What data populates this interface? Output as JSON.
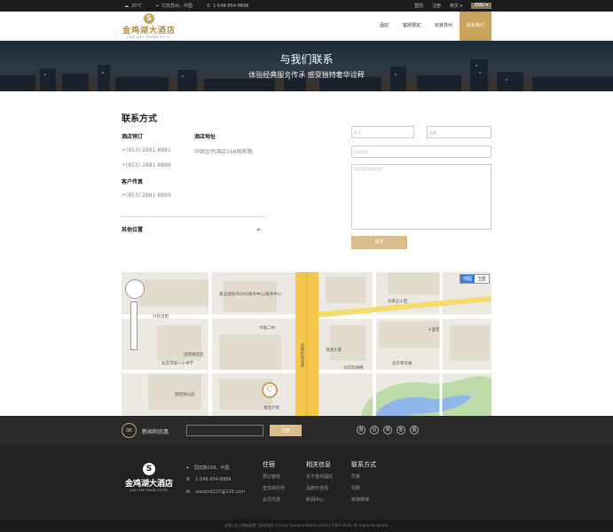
{
  "topbar": {
    "weather": "20℃",
    "location": "江苏苏州，中国",
    "phone": "1-548-854-8898",
    "links": [
      "登陆",
      "注册",
      "英文 ▾"
    ],
    "lang": "ENG ▾"
  },
  "brand": {
    "name_cn": "金鸡湖大酒店",
    "name_en": "JINJI LAKE GRAND HOTEL",
    "mark": "S"
  },
  "nav": [
    "酒店",
    "客房预定",
    "玩转苏州",
    "联系我们"
  ],
  "banner": {
    "title": "与我们联系",
    "subtitle": "体验经典服务传承 感受独特奢华诠释"
  },
  "contact": {
    "title": "联系方式",
    "booking_label": "酒店预订",
    "booking_phones": [
      "+(853) 2881-8881",
      "+(853) 2881-8888"
    ],
    "fax_label": "客户传真",
    "fax_phone": "+(853) 2881-8899",
    "address_label": "酒店地址",
    "address": "中国金鸡酒店168国宾路",
    "other_locations": "其他位置"
  },
  "form": {
    "name_ph": "姓名",
    "email_ph": "邮箱",
    "contact_ph": "联系电话",
    "message_ph": "请给我们留言信息",
    "submit": "提交"
  },
  "map": {
    "toggle_map": "地图",
    "toggle_sat": "卫星",
    "labels": [
      "嘉业国际/SOHO商务中心/服务中心",
      "白家庄小区",
      "团结湖北区",
      "北京市第八十中学",
      "光华科研楼",
      "博瑞大厦",
      "北京青年报",
      "团结湖公园",
      "兴达出租",
      "首都机场高速",
      "金台夕照",
      "十里堡",
      "幸福二村"
    ]
  },
  "newsletter": {
    "label": "新闻和优惠",
    "button": "注册"
  },
  "social": [
    "微",
    "信",
    "博",
    "客",
    "圈"
  ],
  "footer": {
    "address": "国宾路168、中国",
    "phone": "1-548-854-8898",
    "email": "xiaojin0227@126.com",
    "cols": [
      {
        "head": "住宿",
        "items": [
          "预订客房",
          "查找目的地",
          "会员优惠"
        ]
      },
      {
        "head": "相关信息",
        "items": [
          "关于金鸡酒店",
          "品牌价值观",
          "新闻中心"
        ]
      },
      {
        "head": "联系方式",
        "items": [
          "优惠",
          "招聘",
          "新浪微博"
        ]
      }
    ],
    "copyright": "法律公告 | 隐私政策 | 网站地图 | ©Four Seasons Hotels Limited 1997-2016. All Rights Reserved."
  },
  "colors": {
    "gold": "#c9a35c",
    "dark": "#222222",
    "button": "#d8bd8a",
    "blue": "#3a7bd5"
  }
}
